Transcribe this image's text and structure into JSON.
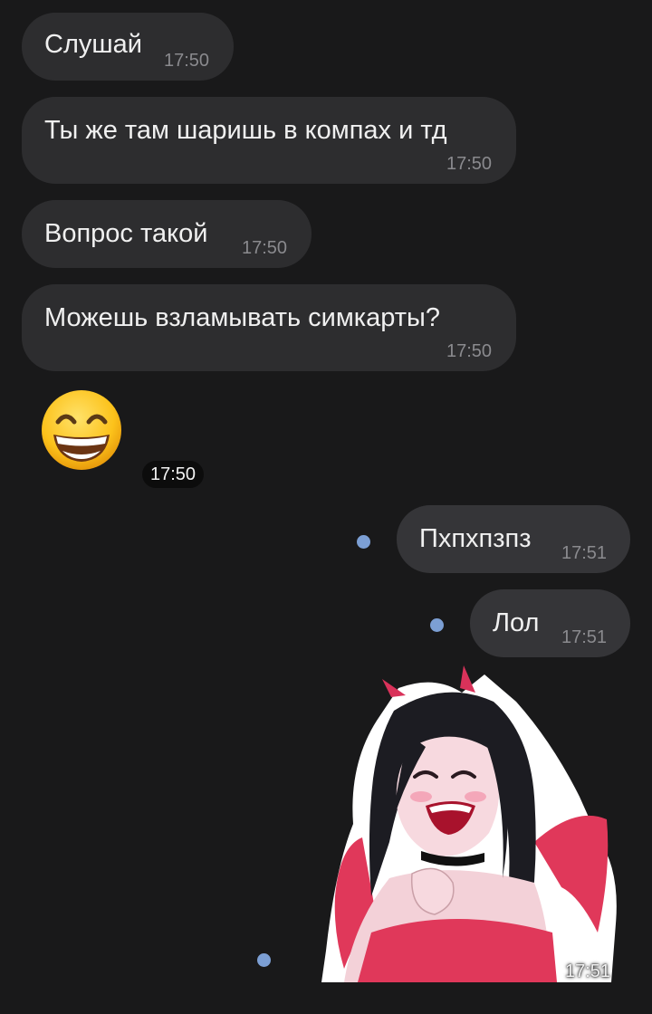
{
  "incoming": [
    {
      "text": "Слушай",
      "time": "17:50"
    },
    {
      "text": "Ты же там шаришь в компах и тд",
      "time": "17:50"
    },
    {
      "text": "Вопрос такой",
      "time": "17:50"
    },
    {
      "text": "Можешь взламывать симкарты?",
      "time": "17:50"
    }
  ],
  "emoji_message": {
    "emoji": "grinning-face-with-smiling-eyes",
    "time": "17:50"
  },
  "outgoing": [
    {
      "text": "Пхпхпзпз",
      "time": "17:51"
    },
    {
      "text": "Лол",
      "time": "17:51"
    }
  ],
  "sticker_message": {
    "sticker": "devil-girl-laughing",
    "time": "17:51"
  },
  "colors": {
    "background": "#19191a",
    "incoming_bubble": "#2d2d2f",
    "outgoing_bubble": "#353538",
    "unread_dot": "#7c9fd4",
    "timestamp": "#8a8a8e"
  }
}
